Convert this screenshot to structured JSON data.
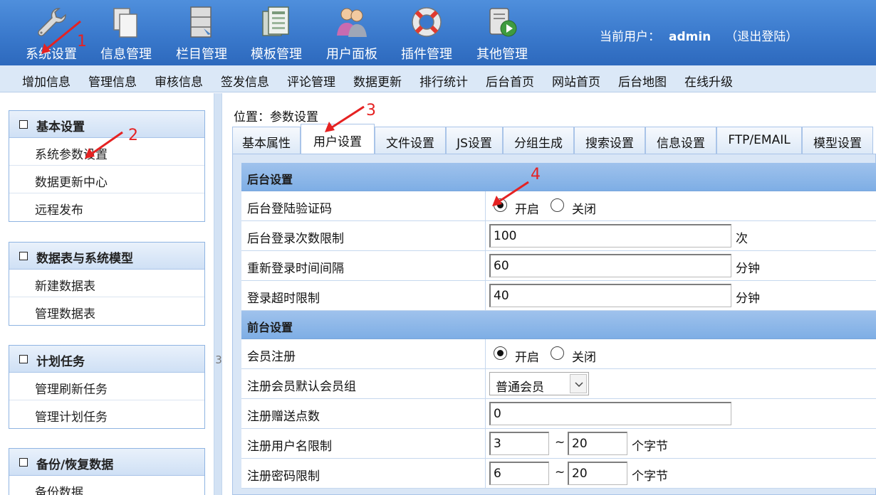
{
  "topbar": {
    "items": [
      {
        "label": "系统设置",
        "icon": "wrench-icon"
      },
      {
        "label": "信息管理",
        "icon": "documents-icon"
      },
      {
        "label": "栏目管理",
        "icon": "column-cabinet-icon"
      },
      {
        "label": "模板管理",
        "icon": "template-icon"
      },
      {
        "label": "用户面板",
        "icon": "users-icon"
      },
      {
        "label": "插件管理",
        "icon": "lifebuoy-icon"
      },
      {
        "label": "其他管理",
        "icon": "scroll-play-icon"
      }
    ],
    "user_prefix": "当前用户：",
    "username": "admin",
    "logout": "（退出登陆）"
  },
  "subnav": {
    "items": [
      "增加信息",
      "管理信息",
      "审核信息",
      "签发信息",
      "评论管理",
      "数据更新",
      "排行统计",
      "后台首页",
      "网站首页",
      "后台地图",
      "在线升级"
    ]
  },
  "sidebar": {
    "groups": [
      {
        "title": "基本设置",
        "items": [
          "系统参数设置",
          "数据更新中心",
          "远程发布"
        ]
      },
      {
        "title": "数据表与系统模型",
        "items": [
          "新建数据表",
          "管理数据表"
        ]
      },
      {
        "title": "计划任务",
        "items": [
          "管理刷新任务",
          "管理计划任务"
        ]
      },
      {
        "title": "备份/恢复数据",
        "items": [
          "备份数据"
        ]
      }
    ]
  },
  "splitter": {
    "arrow": "3"
  },
  "main": {
    "location_prefix": "位置：",
    "location": "参数设置",
    "tabs": [
      "基本属性",
      "用户设置",
      "文件设置",
      "JS设置",
      "分组生成",
      "搜索设置",
      "信息设置",
      "FTP/EMAIL",
      "模型设置"
    ],
    "active_tab": "用户设置",
    "backend": {
      "title": "后台设置",
      "captcha_label": "后台登陆验证码",
      "captcha_on": "开启",
      "captcha_off": "关闭",
      "captcha_value": "开启",
      "login_limit_label": "后台登录次数限制",
      "login_limit": "100",
      "login_limit_unit": "次",
      "relogin_label": "重新登录时间间隔",
      "relogin": "60",
      "relogin_unit": "分钟",
      "timeout_label": "登录超时限制",
      "timeout": "40",
      "timeout_unit": "分钟"
    },
    "frontend": {
      "title": "前台设置",
      "register_label": "会员注册",
      "register_on": "开启",
      "register_off": "关闭",
      "register_value": "开启",
      "group_label": "注册会员默认会员组",
      "group_value": "普通会员",
      "points_label": "注册赠送点数",
      "points": "0",
      "username_label": "注册用户名限制",
      "username_min": "3",
      "username_max": "20",
      "username_unit": "个字节",
      "password_label": "注册密码限制",
      "password_min": "6",
      "password_max": "20",
      "password_unit": "个字节",
      "range_sep": "~"
    }
  },
  "annotations": [
    "1",
    "2",
    "3",
    "4"
  ],
  "colors": {
    "annotation": "#e52222",
    "topbar": "#3a79cc",
    "subnav": "#dbe8f7",
    "section_head": "#8ab6e8"
  }
}
